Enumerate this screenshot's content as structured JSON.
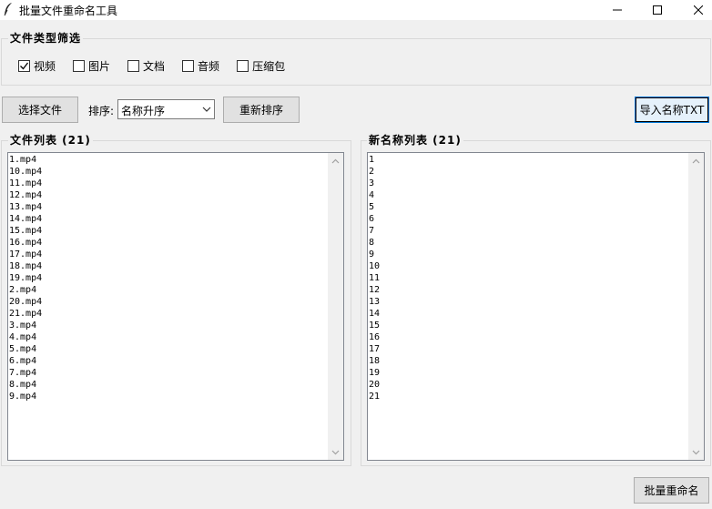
{
  "window": {
    "title": "批量文件重命名工具",
    "icon": "feather-icon"
  },
  "filter_group": {
    "label": "文件类型筛选",
    "options": [
      {
        "label": "视频",
        "checked": true
      },
      {
        "label": "图片",
        "checked": false
      },
      {
        "label": "文档",
        "checked": false
      },
      {
        "label": "音频",
        "checked": false
      },
      {
        "label": "压缩包",
        "checked": false
      }
    ]
  },
  "toolbar": {
    "select_files_label": "选择文件",
    "sort_label": "排序:",
    "sort_value": "名称升序",
    "resort_label": "重新排序",
    "import_label": "导入名称TXT"
  },
  "file_list": {
    "label": "文件列表 (21)",
    "items": [
      "1.mp4",
      "10.mp4",
      "11.mp4",
      "12.mp4",
      "13.mp4",
      "14.mp4",
      "15.mp4",
      "16.mp4",
      "17.mp4",
      "18.mp4",
      "19.mp4",
      "2.mp4",
      "20.mp4",
      "21.mp4",
      "3.mp4",
      "4.mp4",
      "5.mp4",
      "6.mp4",
      "7.mp4",
      "8.mp4",
      "9.mp4"
    ]
  },
  "new_name_list": {
    "label": "新名称列表 (21)",
    "items": [
      "1",
      "2",
      "3",
      "4",
      "5",
      "6",
      "7",
      "8",
      "9",
      "10",
      "11",
      "12",
      "13",
      "14",
      "15",
      "16",
      "17",
      "18",
      "19",
      "20",
      "21"
    ]
  },
  "footer": {
    "batch_rename_label": "批量重命名"
  }
}
